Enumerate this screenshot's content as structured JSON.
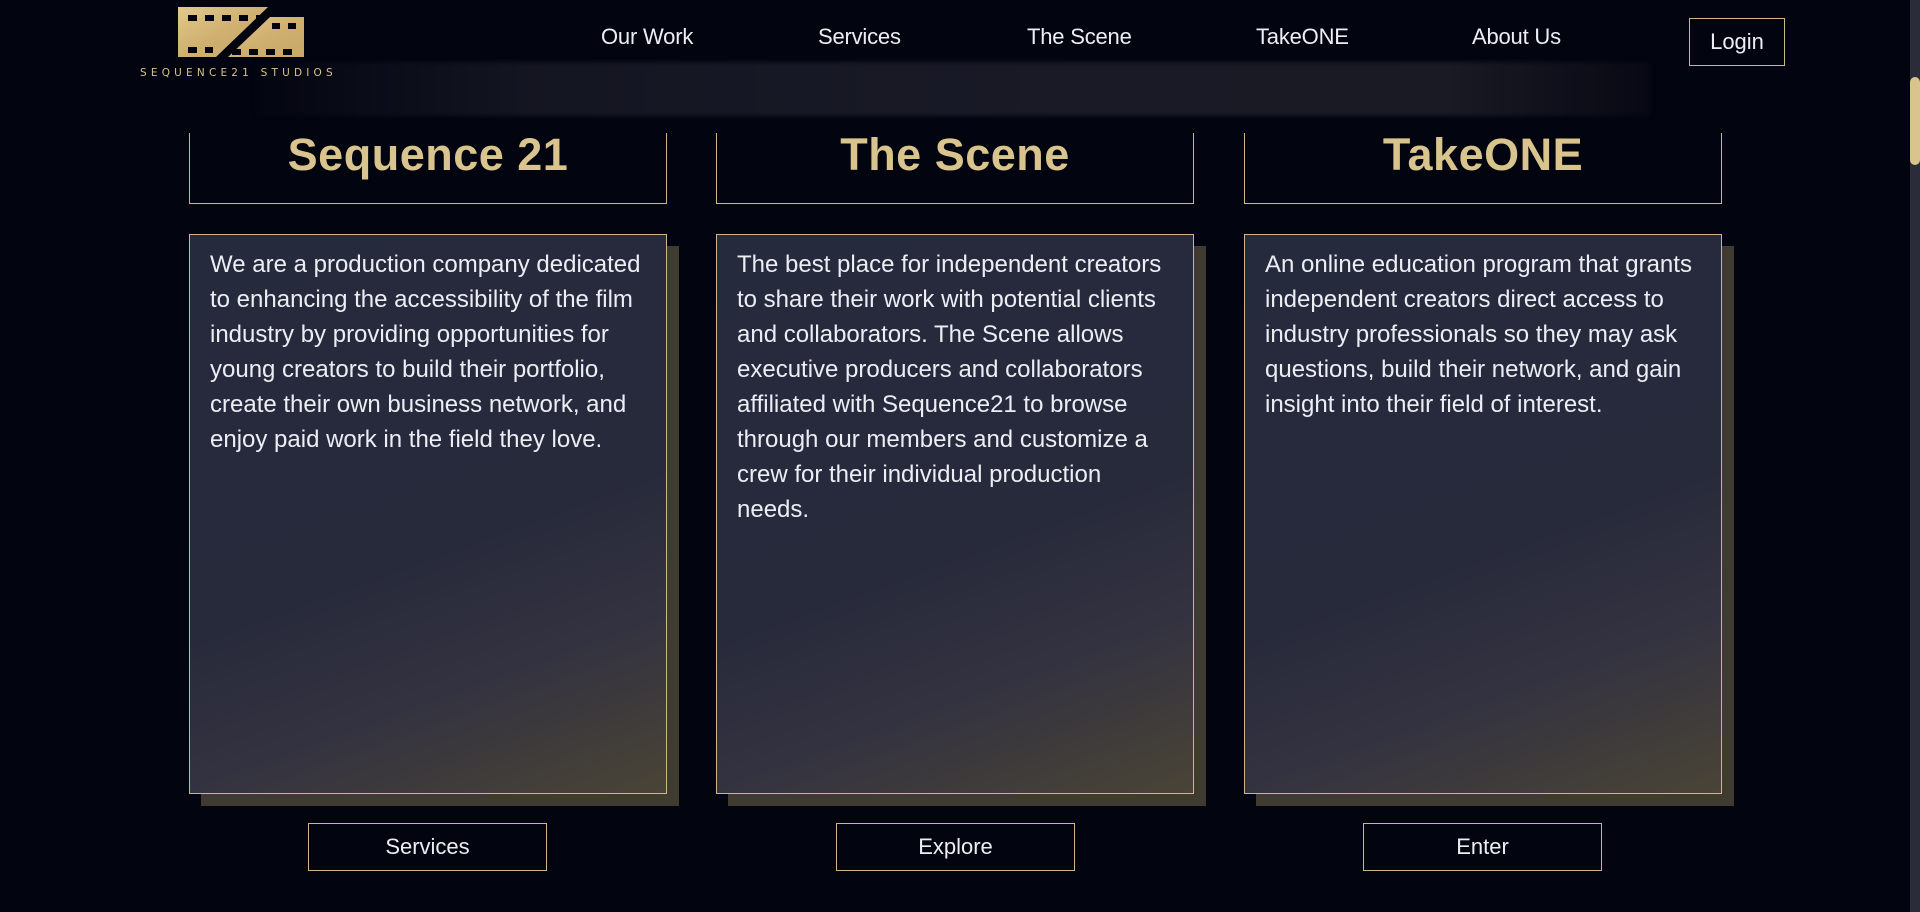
{
  "brand": {
    "name": "SEQUENCE21 STUDIOS",
    "logo_icon": "film-strip-icon",
    "accent_color": "#d8c48c",
    "border_color": "#cdb784",
    "background_color": "#02040f"
  },
  "nav": {
    "items": [
      {
        "label": "Our Work"
      },
      {
        "label": "Services"
      },
      {
        "label": "The Scene"
      },
      {
        "label": "TakeONE"
      },
      {
        "label": "About Us"
      }
    ],
    "login_label": "Login"
  },
  "cards": [
    {
      "title": "Sequence 21",
      "text": "We are a production company dedicated to enhancing the accessibility of the film industry by providing opportunities for young creators to build their portfolio, create their own business network, and enjoy paid work in the field they love.",
      "button_label": "Services"
    },
    {
      "title": "The Scene",
      "text": "The best place for independent creators to share their work with potential clients and collaborators. The Scene allows executive producers and collaborators affiliated with Sequence21 to browse through our members and customize a crew for their individual production needs.",
      "button_label": "Explore"
    },
    {
      "title": "TakeONE",
      "text": "An online education program that grants independent creators direct access to industry professionals so they may ask questions, build their network, and gain insight into their field of interest.",
      "button_label": "Enter"
    }
  ]
}
